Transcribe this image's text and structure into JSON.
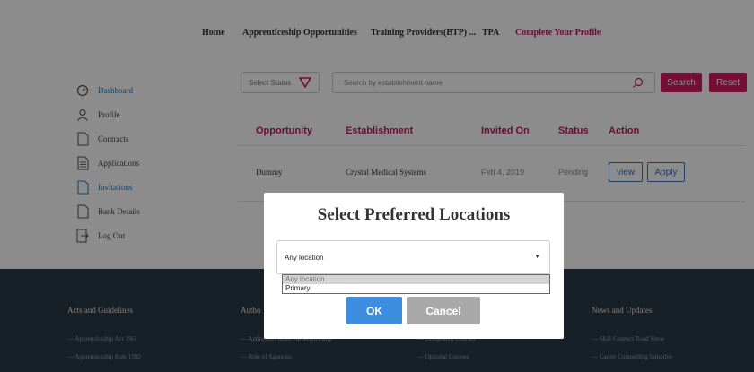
{
  "nav": {
    "items": [
      {
        "label": "Home",
        "active": false
      },
      {
        "label": "Apprenticeship Opportunities",
        "active": false
      },
      {
        "label": "Training Providers(BTP) ...",
        "active": false
      },
      {
        "label": "TPA",
        "active": false
      },
      {
        "label": "Complete Your Profile",
        "active": true
      }
    ]
  },
  "sidebar": {
    "items": [
      {
        "label": "Dashboard",
        "icon": "speedometer-icon",
        "active": true
      },
      {
        "label": "Profile",
        "icon": "person-icon",
        "active": false
      },
      {
        "label": "Contracts",
        "icon": "document-icon",
        "active": false
      },
      {
        "label": "Applications",
        "icon": "list-document-icon",
        "active": false
      },
      {
        "label": "Invitations",
        "icon": "document-icon",
        "active": true
      },
      {
        "label": "Bank Details",
        "icon": "document-icon",
        "active": false
      },
      {
        "label": "Log Out",
        "icon": "logout-icon",
        "active": false
      }
    ]
  },
  "filters": {
    "status_placeholder": "Select Status",
    "search_placeholder": "Search by establishment name",
    "search_label": "Search",
    "reset_label": "Reset"
  },
  "table": {
    "headers": [
      "Opportunity",
      "Establishment",
      "Invited On",
      "Status",
      "Action"
    ],
    "rows": [
      {
        "opportunity": "Dummy",
        "establishment": "Crystal Medical Systems",
        "invited_on": "Feb 4, 2019",
        "status": "Pending",
        "view_label": "view",
        "apply_label": "Apply"
      }
    ]
  },
  "footer": {
    "columns": [
      {
        "title": "Acts and Guidelines",
        "links": [
          "Apprenticeship Act 1961",
          "Apprenticeship Rule 1992"
        ]
      },
      {
        "title": "Autho",
        "links": [
          "Authorities under Apprenticeship",
          "Role of Agencies"
        ]
      },
      {
        "title": "",
        "links": [
          "Designated Courses",
          "Optional Courses"
        ]
      },
      {
        "title": "News and Updates",
        "links": [
          "Skill Connect Road Show",
          "Career Counselling Initiative"
        ]
      }
    ]
  },
  "modal": {
    "title": "Select Preferred Locations",
    "select_value": "Any location",
    "options": [
      "Any location",
      "Primary"
    ],
    "ok_label": "OK",
    "cancel_label": "Cancel"
  },
  "colors": {
    "accent": "#d81b60",
    "primary_blue": "#3d8de0",
    "footer_bg": "#2b3a47"
  }
}
